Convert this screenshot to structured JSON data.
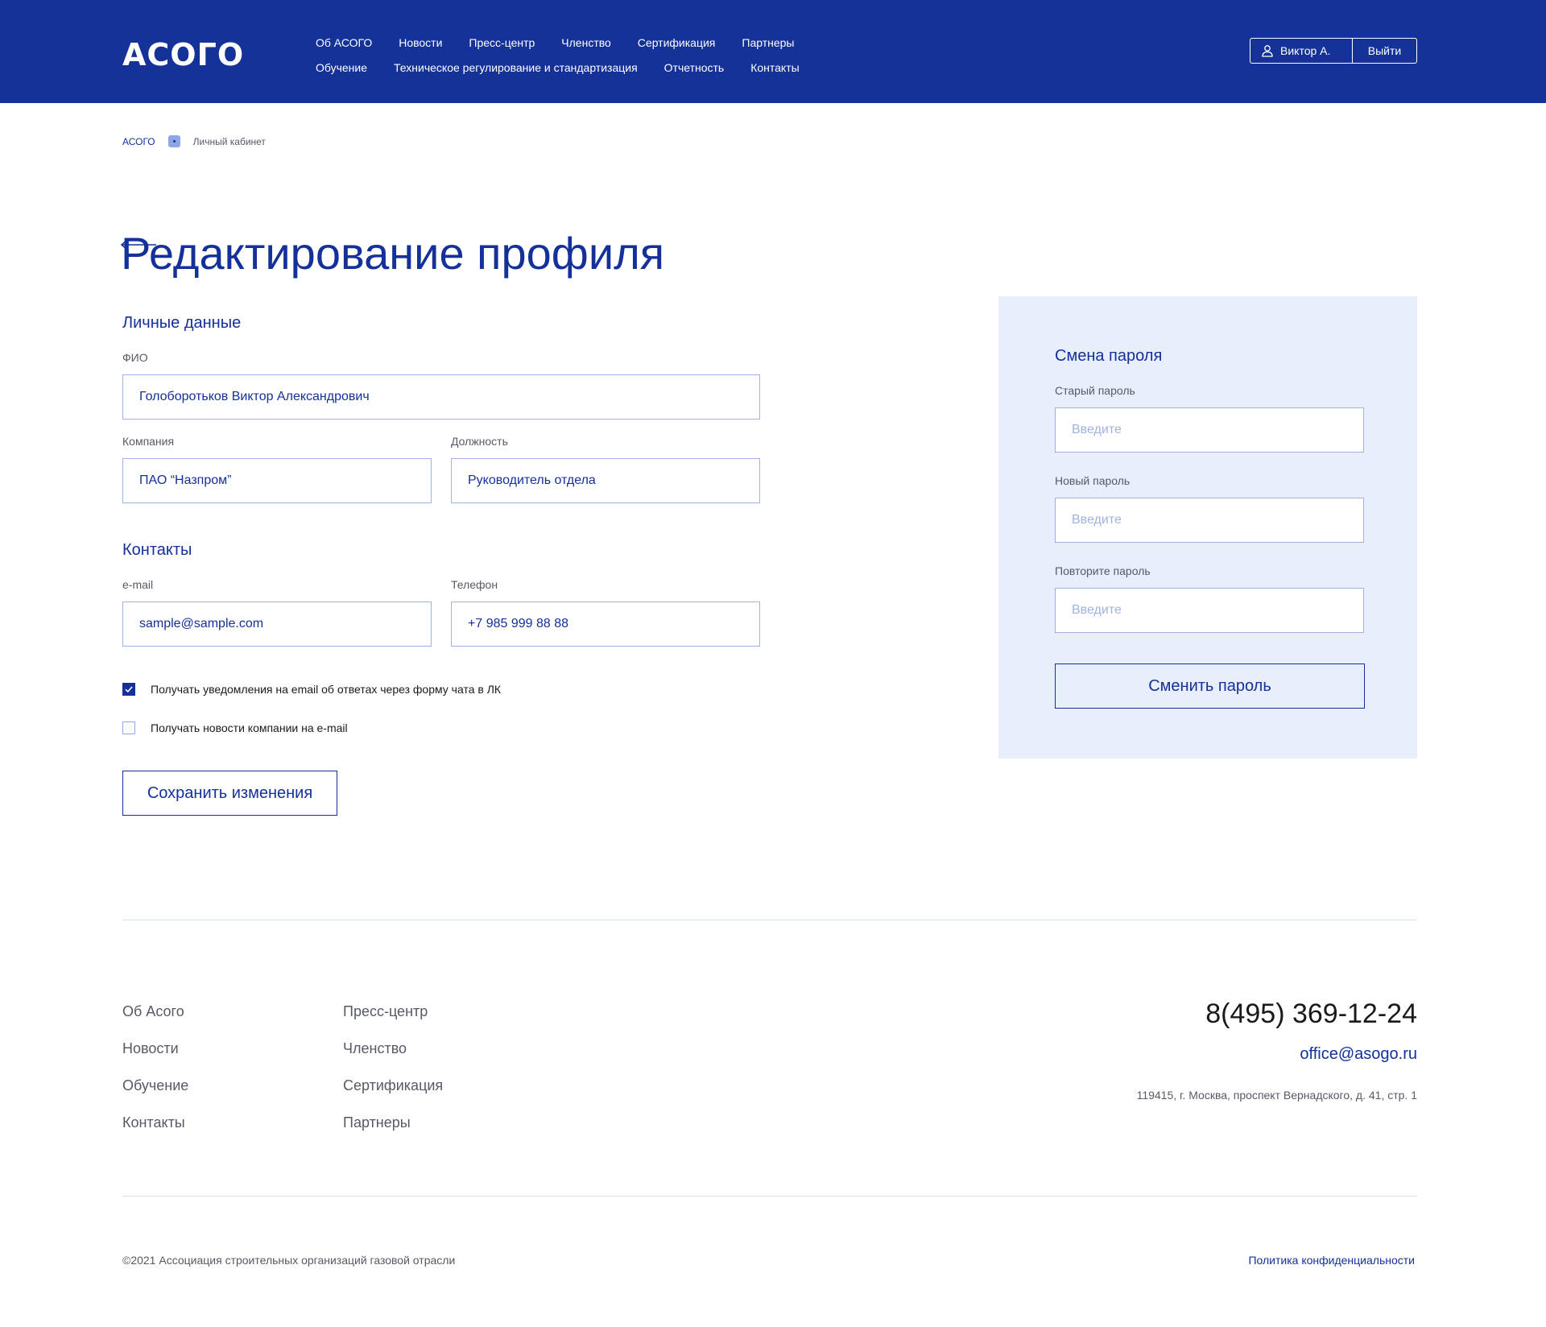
{
  "header": {
    "logo": "АСОГО",
    "nav_row1": [
      "Об АСОГО",
      "Новости",
      "Пресс-центр",
      "Членство",
      "Сертификация",
      "Партнеры"
    ],
    "nav_row2": [
      "Обучение",
      "Техническое регулирование и стандартизация",
      "Отчетность",
      "Контакты"
    ],
    "user_name": "Виктор А.",
    "logout_label": "Выйти"
  },
  "breadcrumb": {
    "home": "АСОГО",
    "current": "Личный кабинет"
  },
  "page_title": "Редактирование профиля",
  "personal": {
    "section_title": "Личные данные",
    "fio_label": "ФИО",
    "fio_value": "Голоборотьков Виктор Александрович",
    "company_label": "Компания",
    "company_value": "ПАО “Назпром”",
    "position_label": "Должность",
    "position_value": "Руководитель отдела"
  },
  "contacts": {
    "section_title": "Контакты",
    "email_label": "e-mail",
    "email_value": "sample@sample.com",
    "phone_label": "Телефон",
    "phone_value": "+7 985 999 88 88"
  },
  "checkboxes": [
    {
      "label": "Получать уведомления на email об ответах через форму чата в ЛК",
      "checked": true
    },
    {
      "label": "Получать новости компании на e-mail",
      "checked": false
    }
  ],
  "save_button": "Сохранить изменения",
  "password": {
    "title": "Смена пароля",
    "old_label": "Старый пароль",
    "new_label": "Новый пароль",
    "repeat_label": "Повторите пароль",
    "placeholder": "Введите",
    "button": "Сменить пароль"
  },
  "footer": {
    "col1": [
      "Об Асого",
      "Новости",
      "Обучение",
      "Контакты"
    ],
    "col2": [
      "Пресс-центр",
      "Членство",
      "Сертификация",
      "Партнеры"
    ],
    "phone": "8(495) 369-12-24",
    "email": "office@asogo.ru",
    "address": "119415, г. Москва, проспект Вернадского, д. 41, стр. 1",
    "copyright": "©2021 Ассоциация строительных организаций газовой отрасли",
    "privacy": "Политика конфиденциальности"
  },
  "colors": {
    "brand": "#143297",
    "panel": "#e8eefb",
    "input_border": "#9fb2e4"
  }
}
